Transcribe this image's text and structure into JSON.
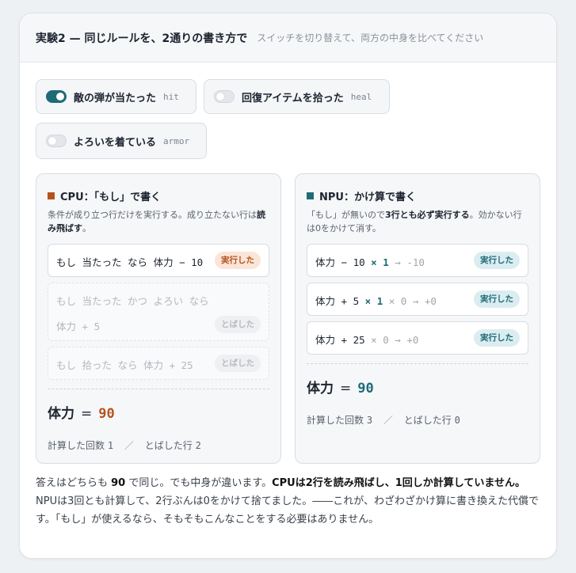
{
  "header": {
    "title": "実験2 — 同じルールを、2通りの書き方で",
    "subtitle": "スイッチを切り替えて、両方の中身を比べてください"
  },
  "toggles": [
    {
      "label": "敵の弾が当たった",
      "code": "hit",
      "on": true
    },
    {
      "label": "回復アイテムを拾った",
      "code": "heal",
      "on": false
    },
    {
      "label": "よろいを着ている",
      "code": "armor",
      "on": false
    }
  ],
  "colors": {
    "cpu_accent": "#b4521c",
    "npu_accent": "#1e6b78"
  },
  "cpu": {
    "title": "CPU：「もし」で書く",
    "desc_plain": "条件が成り立つ行だけを実行する。成り立たない行は",
    "desc_bold": "読み飛ばす",
    "desc_end": "。",
    "rows": [
      {
        "text": "もし 当たった なら 体力 − 10",
        "badge": "実行した"
      },
      {
        "text_line1": "もし 当たった かつ よろい なら",
        "text_line2": "体力 + 5",
        "badge": "とばした"
      },
      {
        "text": "もし 拾った なら 体力 + 25",
        "badge": "とばした"
      }
    ],
    "hp_label": "体力",
    "eq": "=",
    "hp_value": "90",
    "stats_calc_label": "計算した回数",
    "stats_calc_value": "1",
    "stats_sep": "／",
    "stats_skip_label": "とばした行",
    "stats_skip_value": "2"
  },
  "npu": {
    "title": "NPU：かけ算で書く",
    "desc_plain": "「もし」が無いので",
    "desc_bold": "3行とも必ず実行する",
    "desc_end": "。効かない行は0をかけて消す。",
    "rows": [
      {
        "lhs": "体力 − 10",
        "mul": "× 1",
        "rhs": "→ -10",
        "badge": "実行した"
      },
      {
        "lhs": "体力 + 5",
        "mul": "× 1",
        "rhs": "× 0 → +0",
        "badge": "実行した"
      },
      {
        "lhs": "体力 + 25",
        "mul": "",
        "rhs": "× 0 → +0",
        "badge": "実行した"
      }
    ],
    "hp_label": "体力",
    "eq": "=",
    "hp_value": "90",
    "stats_calc_label": "計算した回数",
    "stats_calc_value": "3",
    "stats_sep": "／",
    "stats_skip_label": "とばした行",
    "stats_skip_value": "0"
  },
  "footer": {
    "p1": "答えはどちらも ",
    "p1_bold": "90",
    "p2": " で同じ。でも中身が違います。",
    "p2_bold": "CPUは2行を読み飛ばし、1回しか計算していません。",
    "p3": "NPUは3回とも計算して、2行ぶんは0をかけて捨てました。――これが、わざわざかけ算に書き換えた代償です。「もし」が使えるなら、そもそもこんなことをする必要はありません。"
  }
}
